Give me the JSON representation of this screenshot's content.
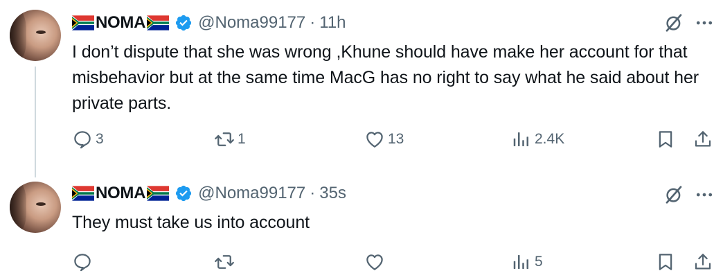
{
  "tweets": [
    {
      "display_name": "NOMA",
      "handle": "@Noma99177",
      "separator": "·",
      "time": "11h",
      "text": "I don’t dispute that she was wrong ,Khune should have make her account for that misbehavior but at the same time MacG has no right to say what he said about her private parts.",
      "replies": "3",
      "reposts": "1",
      "likes": "13",
      "views": "2.4K"
    },
    {
      "display_name": "NOMA",
      "handle": "@Noma99177",
      "separator": "·",
      "time": "35s",
      "text": "They must take us into account",
      "replies": "",
      "reposts": "",
      "likes": "",
      "views": "5"
    }
  ],
  "icons": {
    "flag": "south-africa-flag",
    "verified": "verified-badge-icon",
    "grok": "grok-icon",
    "more": "more-icon",
    "reply": "reply-icon",
    "repost": "repost-icon",
    "like": "heart-icon",
    "views": "views-icon",
    "bookmark": "bookmark-icon",
    "share": "share-icon"
  },
  "colors": {
    "text": "#0f1419",
    "secondary": "#536471",
    "verified": "#1d9bf0",
    "thread_line": "#cfd9de"
  }
}
